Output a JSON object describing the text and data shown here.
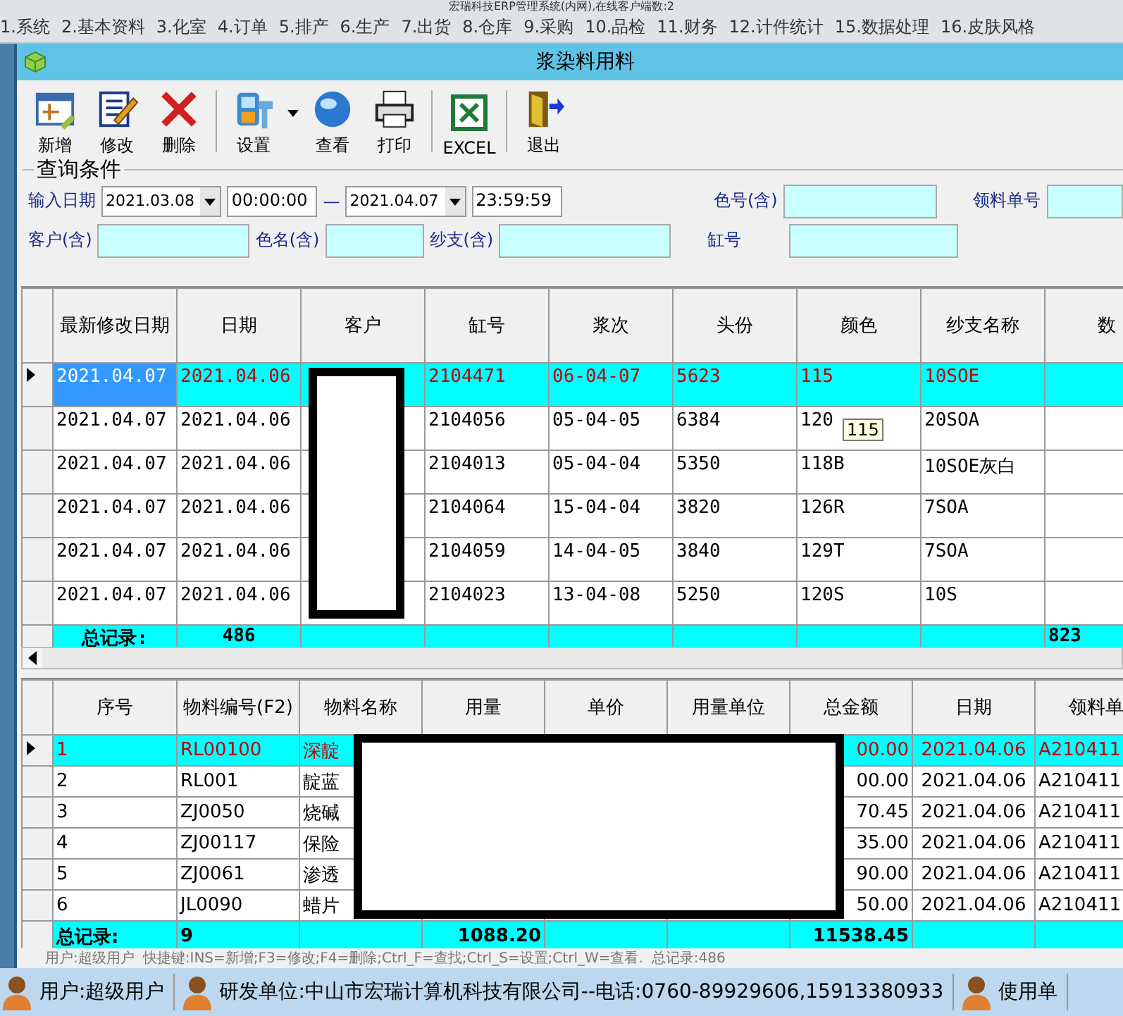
{
  "app_title": "宏瑞科技ERP管理系统(内网),在线客户端数:2",
  "menu": [
    "1.系统",
    "2.基本资料",
    "3.化室",
    "4.订单",
    "5.排产",
    "6.生产",
    "7.出货",
    "8.仓库",
    "9.采购",
    "10.品检",
    "11.财务",
    "12.计件统计",
    "15.数据处理",
    "16.皮肤风格"
  ],
  "window": {
    "title": "浆染料用料"
  },
  "toolbar": [
    {
      "label": "新增",
      "kind": "new"
    },
    {
      "label": "修改",
      "kind": "edit"
    },
    {
      "label": "删除",
      "kind": "delete"
    },
    {
      "kind": "separator"
    },
    {
      "label": "设置",
      "kind": "settings"
    },
    {
      "kind": "dropdown"
    },
    {
      "label": "查看",
      "kind": "view"
    },
    {
      "label": "打印",
      "kind": "print"
    },
    {
      "kind": "separator"
    },
    {
      "label": "EXCEL",
      "kind": "excel"
    },
    {
      "kind": "separator"
    },
    {
      "label": "退出",
      "kind": "exit"
    }
  ],
  "query": {
    "title": "查询条件",
    "row1": [
      {
        "kind": "label",
        "text": "输入日期"
      },
      {
        "kind": "date",
        "value": "2021.03.08"
      },
      {
        "kind": "time",
        "value": "00:00:00"
      },
      {
        "kind": "dash",
        "text": "—"
      },
      {
        "kind": "date",
        "value": "2021.04.07"
      },
      {
        "kind": "time",
        "value": "23:59:59"
      },
      {
        "kind": "label",
        "text": "色号(含)"
      },
      {
        "kind": "field"
      },
      {
        "kind": "label",
        "text": "领料单号"
      },
      {
        "kind": "field"
      }
    ],
    "row2": [
      {
        "kind": "label",
        "text": "客户(含)"
      },
      {
        "kind": "field"
      },
      {
        "kind": "label",
        "text": "色名(含)"
      },
      {
        "kind": "field"
      },
      {
        "kind": "label",
        "text": "纱支(含)"
      },
      {
        "kind": "field"
      },
      {
        "kind": "label",
        "text": "缸号"
      },
      {
        "kind": "field"
      }
    ]
  },
  "upper_table": {
    "columns": [
      "最新修改日期",
      "日期",
      "客户",
      "缸号",
      "浆次",
      "头份",
      "颜色",
      "纱支名称",
      "数"
    ],
    "rows": [
      {
        "selected": true,
        "modified": "2021.04.07",
        "date": "2021.04.06",
        "vat": "2104471",
        "batch": "06-04-07",
        "head": "5623",
        "shade": "115",
        "yarn": "10SOE"
      },
      {
        "selected": false,
        "modified": "2021.04.07",
        "date": "2021.04.06",
        "vat": "2104056",
        "batch": "05-04-05",
        "head": "6384",
        "shade": "120",
        "yarn": "20SOA"
      },
      {
        "selected": false,
        "modified": "2021.04.07",
        "date": "2021.04.06",
        "vat": "2104013",
        "batch": "05-04-04",
        "head": "5350",
        "shade": "118B",
        "yarn": "10SOE灰白"
      },
      {
        "selected": false,
        "modified": "2021.04.07",
        "date": "2021.04.06",
        "vat": "2104064",
        "batch": "15-04-04",
        "head": "3820",
        "shade": "126R",
        "yarn": "7SOA"
      },
      {
        "selected": false,
        "modified": "2021.04.07",
        "date": "2021.04.06",
        "vat": "2104059",
        "batch": "14-04-05",
        "head": "3840",
        "shade": "129T",
        "yarn": "7SOA"
      },
      {
        "selected": false,
        "modified": "2021.04.07",
        "date": "2021.04.06",
        "vat": "2104023",
        "batch": "13-04-08",
        "head": "5250",
        "shade": "120S",
        "yarn": "10S"
      }
    ],
    "totals": {
      "label": "总记录:",
      "count": "486",
      "quantity": "823"
    },
    "tooltip": "115"
  },
  "lower_table": {
    "columns": [
      "序号",
      "物料编号(F2)",
      "物料名称",
      "用量",
      "单价",
      "用量单位",
      "总金额",
      "日期",
      "领料单"
    ],
    "rows": [
      {
        "selected": true,
        "seq": "1",
        "code": "RL00100",
        "name": "深靛",
        "total": "00.00",
        "date": "2021.04.06",
        "requisition": "A210411"
      },
      {
        "selected": false,
        "seq": "2",
        "code": "RL001",
        "name": "靛蓝",
        "total": "00.00",
        "date": "2021.04.06",
        "requisition": "A210411"
      },
      {
        "selected": false,
        "seq": "3",
        "code": "ZJ0050",
        "name": "烧碱",
        "total": "70.45",
        "date": "2021.04.06",
        "requisition": "A210411"
      },
      {
        "selected": false,
        "seq": "4",
        "code": "ZJ00117",
        "name": "保险",
        "total": "35.00",
        "date": "2021.04.06",
        "requisition": "A210411"
      },
      {
        "selected": false,
        "seq": "5",
        "code": "ZJ0061",
        "name": "渗透",
        "total": "90.00",
        "date": "2021.04.06",
        "requisition": "A210411"
      },
      {
        "selected": false,
        "seq": "6",
        "code": "JL0090",
        "name": "蜡片",
        "total": "50.00",
        "date": "2021.04.06",
        "requisition": "A210411"
      }
    ],
    "totals": {
      "label": "总记录:",
      "count": "9",
      "usage": "1088.20",
      "total": "11538.45"
    }
  },
  "inner_status": [
    "用户:超级用户",
    "快捷键:INS=新增;F3=修改;F4=删除;Ctrl_F=查找;Ctrl_S=设置;Ctrl_W=查看.",
    "总记录:486"
  ],
  "taskbar": [
    {
      "text": "用户:超级用户"
    },
    {
      "text": "研发单位:中山市宏瑞计算机科技有限公司--电话:0760-89929606,15913380933"
    },
    {
      "text": "使用单"
    }
  ]
}
